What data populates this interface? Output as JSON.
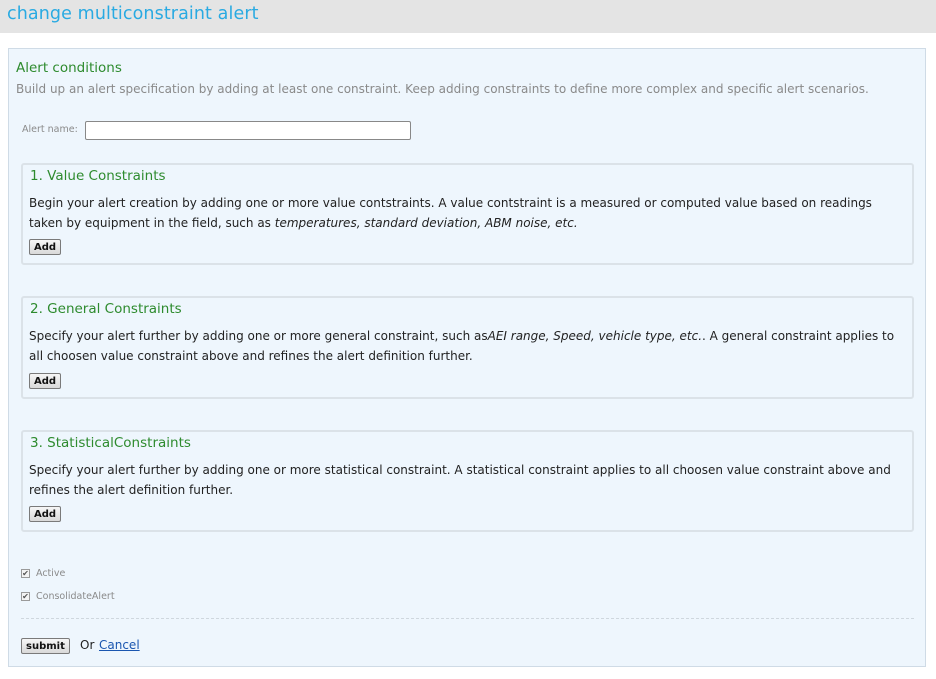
{
  "page": {
    "title": "change multiconstraint alert"
  },
  "alert_conditions": {
    "title": "Alert conditions",
    "description": "Build up an alert specification by adding at least one constraint. Keep adding constraints to define more complex and specific alert scenarios."
  },
  "alert_name": {
    "label": "Alert name:",
    "value": ""
  },
  "value_constraints": {
    "title": "1. Value Constraints",
    "text_part1": "Begin your alert creation by adding one or more value contstraints. A value contstraint is a measured or computed value based on readings taken by equipment in the field, such as ",
    "text_italic": "temperatures, standard deviation, ABM noise, etc.",
    "add_label": "Add"
  },
  "general_constraints": {
    "title": "2. General Constraints",
    "text_part1": "Specify your alert further by adding one or more general constraint, such as",
    "text_italic": "AEI range, Speed, vehicle type, etc.",
    "text_part2": ". A general constraint applies to all choosen value constraint above and refines the alert definition further.",
    "add_label": "Add"
  },
  "statistical_constraints": {
    "title": "3. StatisticalConstraints",
    "text": "Specify your alert further by adding one or more statistical constraint. A statistical constraint applies to all choosen value constraint above and refines the alert definition further.",
    "add_label": "Add"
  },
  "options": {
    "active_label": "Active",
    "active_checked": true,
    "consolidate_label": "ConsolidateAlert",
    "consolidate_checked": true
  },
  "actions": {
    "submit_label": "submit",
    "or_text": "Or",
    "cancel_label": "Cancel"
  },
  "colors": {
    "title_blue": "#29aae2",
    "heading_green": "#2e8b2e",
    "panel_bg": "#eef6fd",
    "header_bg": "#e4e4e4",
    "link_blue": "#1a56b0"
  },
  "icons": {
    "checkbox_checked": "check-mark"
  }
}
